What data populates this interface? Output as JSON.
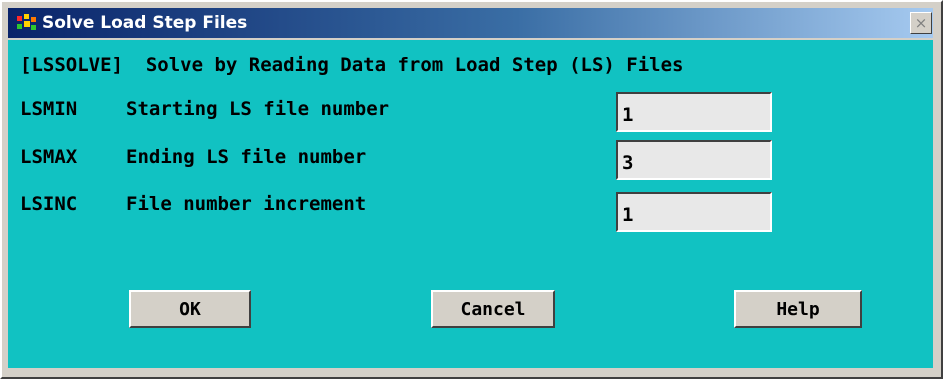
{
  "window": {
    "title": "Solve Load Step Files",
    "close_label": "×"
  },
  "dialog": {
    "header": "[LSSOLVE]  Solve by Reading Data from Load Step (LS) Files",
    "fields": [
      {
        "param": "LSMIN",
        "label": "Starting LS file number",
        "value": "1"
      },
      {
        "param": "LSMAX",
        "label": "Ending LS file number",
        "value": "3"
      },
      {
        "param": "LSINC",
        "label": "File number increment",
        "value": "1"
      }
    ]
  },
  "buttons": {
    "ok": "OK",
    "cancel": "Cancel",
    "help": "Help"
  },
  "colors": {
    "client_background": "#11c2c2",
    "titlebar_start": "#0a246a",
    "titlebar_end": "#a6caf0",
    "field_background": "#e8e8e8"
  },
  "icons": {
    "app": "ansys-app-icon",
    "close": "close-icon"
  }
}
